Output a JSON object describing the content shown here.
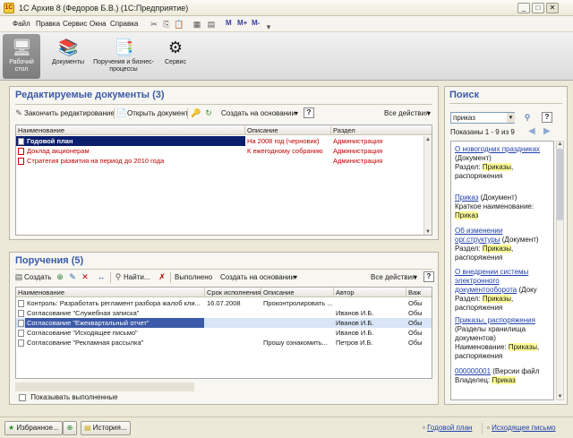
{
  "window": {
    "title": "1С Архив 8 (Федоров Б.В.) (1С:Предприятие)",
    "controls": [
      "_",
      "□",
      "✕"
    ]
  },
  "menubar": {
    "items": [
      "Файл",
      "Правка",
      "Сервис",
      "Окна",
      "Справка"
    ],
    "m_buttons": [
      "M",
      "M+",
      "M-"
    ]
  },
  "sections": [
    {
      "label": "Рабочий стол",
      "icon": "desktop-icon"
    },
    {
      "label": "Документы",
      "icon": "books-icon"
    },
    {
      "label": "Поручения и бизнес-процессы",
      "icon": "tasks-icon"
    },
    {
      "label": "Сервис",
      "icon": "gear-icon"
    }
  ],
  "editing": {
    "title": "Редактируемые документы (3)",
    "toolbar": {
      "finish": "Закончить редактирование",
      "open": "Открыть документ",
      "create_based": "Создать на основании",
      "help": "?",
      "all_actions": "Все действия"
    },
    "columns": [
      "Наименование",
      "Описание",
      "Раздел"
    ],
    "rows": [
      {
        "name": "Годовой план",
        "desc": "На 2008 год (черновик)",
        "section": "Администрация"
      },
      {
        "name": "Доклад акционерам",
        "desc": "К ежегодному собранию",
        "section": "Администрация"
      },
      {
        "name": "Стратегия развития на период до 2010 года",
        "desc": "",
        "section": "Администрация"
      }
    ]
  },
  "tasks": {
    "title": "Поручения (5)",
    "toolbar": {
      "create": "Создать",
      "find": "Найти...",
      "done": "Выполнено",
      "create_based": "Создать на основании",
      "all_actions": "Все действия",
      "help": "?"
    },
    "columns": [
      "Наименование",
      "Срок исполнения",
      "Описание",
      "Автор",
      "Важ"
    ],
    "rows": [
      {
        "name": "Контроль: Разработать регламент разбора жалоб кли...",
        "due": "16.07.2008",
        "desc": "Проконтролировать ...",
        "author": "",
        "imp": "Обы"
      },
      {
        "name": "Согласование \"Служебная записка\"",
        "due": "",
        "desc": "",
        "author": "Иванов И.Б.",
        "imp": "Обы"
      },
      {
        "name": "Согласование \"Ежеквартальный отчет\"",
        "due": "",
        "desc": "",
        "author": "Иванов И.Б.",
        "imp": "Обы"
      },
      {
        "name": "Согласование \"Исходящее письмо\"",
        "due": "",
        "desc": "",
        "author": "Иванов И.Б.",
        "imp": "Обы"
      },
      {
        "name": "Согласование \"Рекламная рассылка\"",
        "due": "",
        "desc": "Прошу ознакомить...",
        "author": "Петров И.Б.",
        "imp": "Обы"
      }
    ],
    "show_done_label": "Показывать выполненные"
  },
  "search": {
    "title": "Поиск",
    "query": "приказ",
    "shown": "Показаны 1 - 9 из 9",
    "help": "?",
    "results": [
      {
        "link": "О новогодних праздниках",
        "type": " (Документ)",
        "line2": "Раздел: ",
        "hl": "Приказы",
        "line3": ", распоряжения"
      },
      {
        "link": "Приказ",
        "type": " (Документ)",
        "line2": "Краткое наименование: ",
        "hl": "Приказ",
        "line3": ""
      },
      {
        "link": "Об изменении орг.структуры",
        "type": " (Документ)",
        "line2": "Раздел: ",
        "hl": "Приказы",
        "line3": ", распоряжения"
      },
      {
        "link": "О внедрении системы электронного документооборота",
        "type": " (Доку",
        "line2": "Раздел: ",
        "hl": "Приказы",
        "line3": ", распоряжения"
      },
      {
        "link": "Приказы, распоряжения",
        "type": " (Разделы хранилища документов)",
        "line2": "Наименование: ",
        "hl": "Приказы",
        "line3": ", распоряжения"
      },
      {
        "link": "000000001",
        "type": " (Версии файл",
        "line2": "Владелец: ",
        "hl": "Приказ",
        "line3": ""
      }
    ]
  },
  "bottom": {
    "favorites": "Избранное...",
    "history": "История...",
    "open_windows": [
      "Годовой план",
      "Исходящее письмо"
    ]
  }
}
